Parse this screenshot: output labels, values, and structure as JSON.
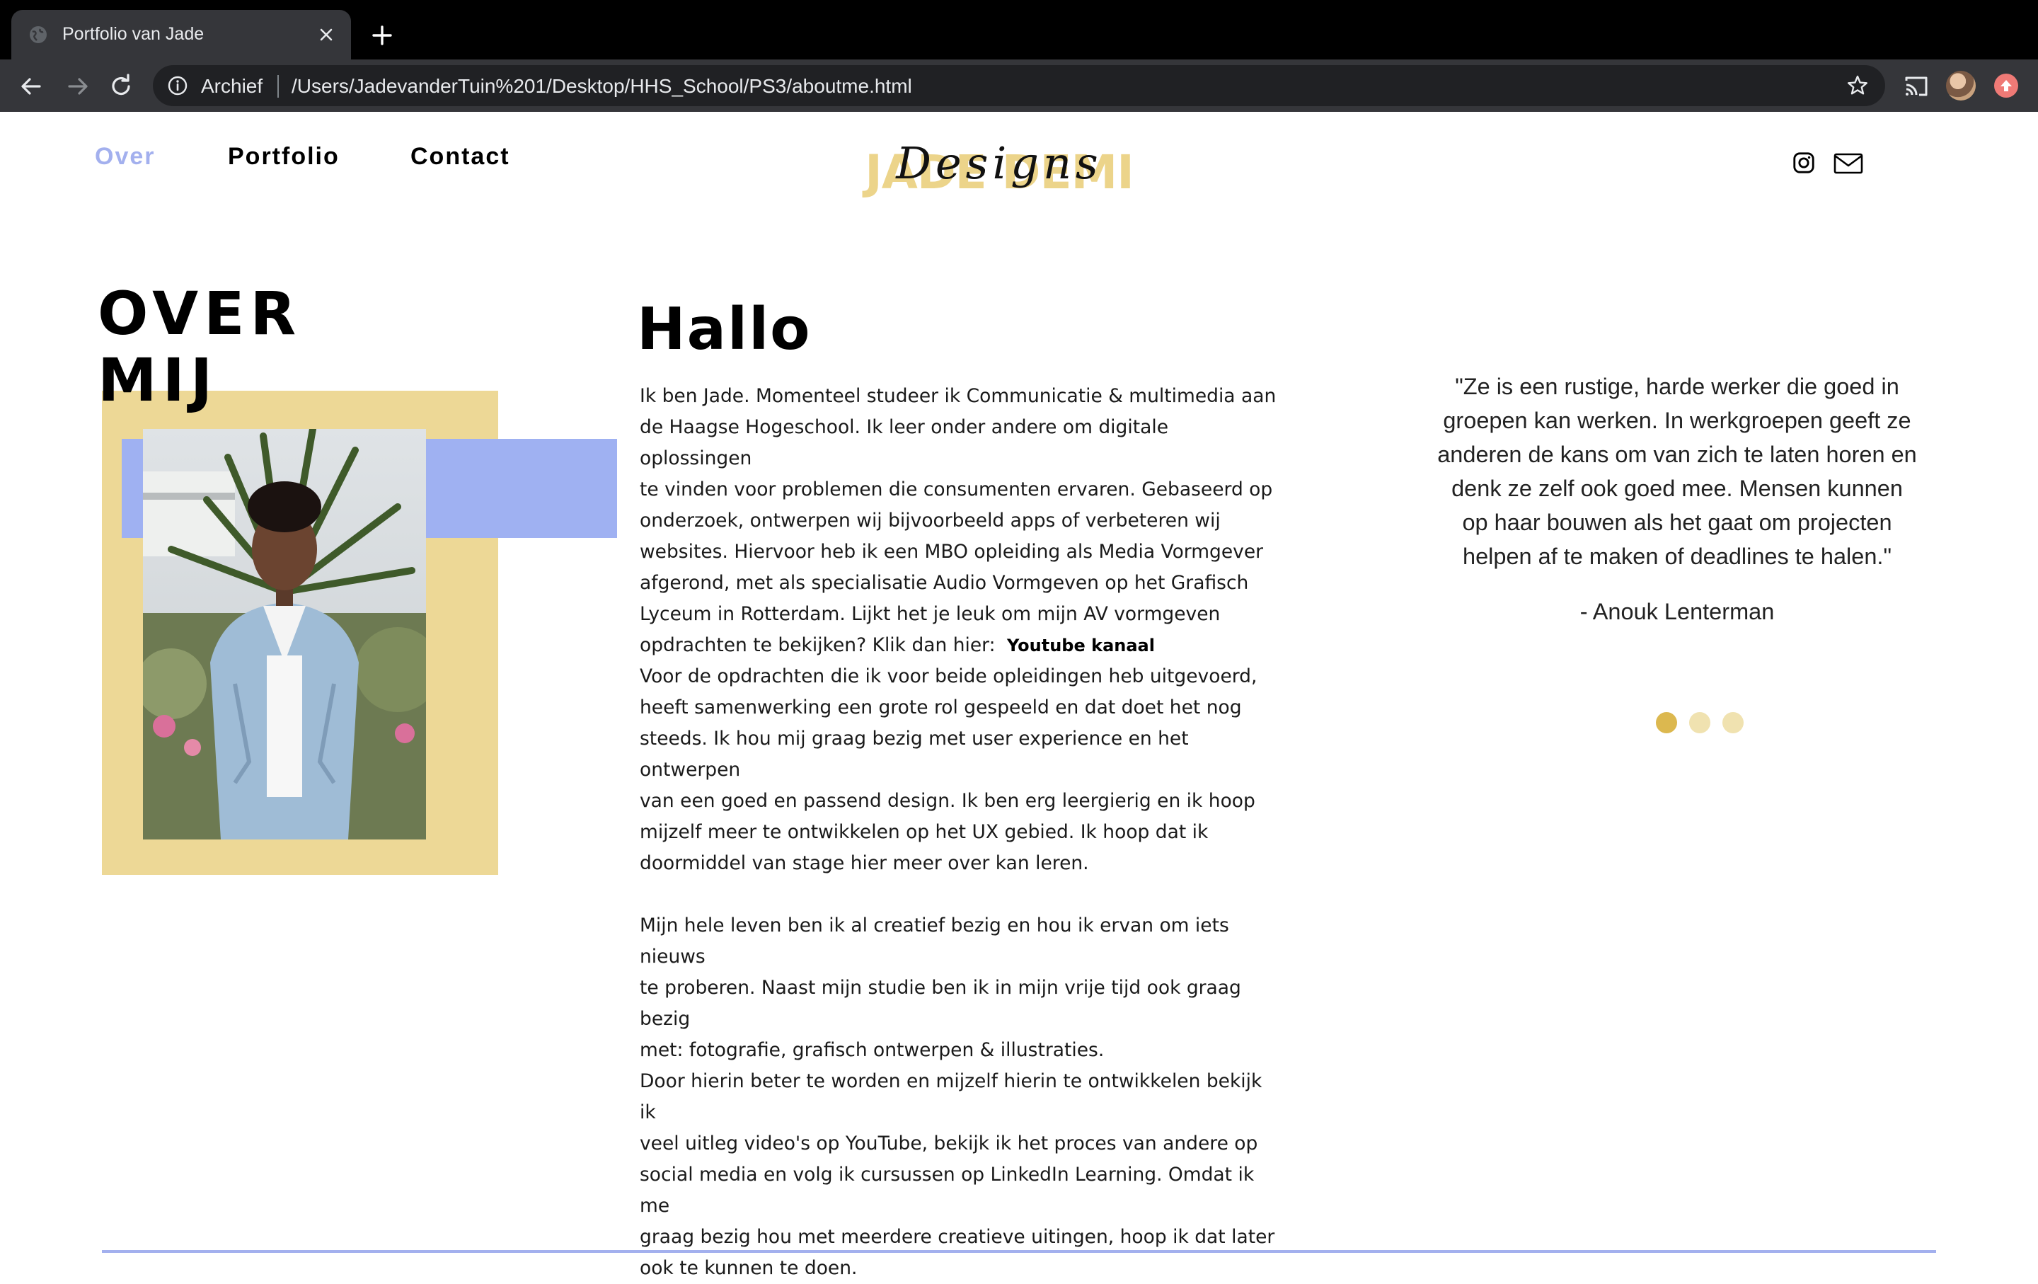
{
  "browser": {
    "tab_title": "Portfolio van Jade",
    "omnibox_label": "Archief",
    "url": "/Users/JadevanderTuin%201/Desktop/HHS_School/PS3/aboutme.html"
  },
  "nav": {
    "links": [
      {
        "label": "Over",
        "active": true
      },
      {
        "label": "Portfolio",
        "active": false
      },
      {
        "label": "Contact",
        "active": false
      }
    ],
    "logo_text_bg": "JADE DEMI",
    "logo_text_script": "Designs"
  },
  "about": {
    "title_line1": "OVER",
    "title_line2": "MIJ",
    "heading": "Hallo",
    "paragraph1_lines": [
      "Ik ben Jade. Momenteel studeer ik Communicatie & multimedia aan",
      "de Haagse Hogeschool. Ik leer onder andere om digitale oplossingen",
      "te vinden voor problemen die consumenten ervaren. Gebaseerd op",
      "onderzoek, ontwerpen wij bijvoorbeeld apps of verbeteren wij",
      "websites. Hiervoor heb ik een MBO opleiding als Media Vormgever",
      "afgerond, met als specialisatie Audio Vormgeven op het Grafisch",
      "Lyceum in Rotterdam. Lijkt het je leuk om mijn AV vormgeven"
    ],
    "paragraph1_last": "opdrachten te bekijken? Klik dan hier:",
    "youtube_link": "Youtube kanaal",
    "paragraph2_lines": [
      "Voor de opdrachten die ik voor beide opleidingen heb uitgevoerd,",
      "heeft samenwerking een grote rol gespeeld en dat doet het nog",
      "steeds. Ik hou mij graag bezig met user experience en het ontwerpen",
      "van een goed en passend design. Ik ben erg leergierig en ik hoop",
      "mijzelf meer te ontwikkelen op het UX gebied. Ik hoop dat ik",
      "doormiddel van stage hier meer over kan leren."
    ],
    "paragraph3_lines": [
      "Mijn hele leven ben ik al creatief bezig en hou ik ervan om iets nieuws",
      "te proberen. Naast mijn studie ben ik in mijn vrije tijd ook graag bezig",
      "met: fotografie, grafisch ontwerpen & illustraties.",
      "Door hierin beter te worden en mijzelf hierin te ontwikkelen bekijk ik",
      "veel uitleg video's op YouTube, bekijk ik het proces van andere op",
      "social media en volg ik cursussen op LinkedIn Learning. Omdat ik me",
      "graag bezig hou met meerdere creatieve uitingen, hoop ik dat later",
      "ook te kunnen te doen."
    ]
  },
  "testimonial": {
    "quote_lines": [
      "\"Ze is een rustige, harde werker die goed in",
      "groepen kan werken. In werkgroepen geeft ze",
      "anderen de kans om van zich te laten horen en",
      "denk ze zelf ook goed mee. Mensen kunnen",
      "op haar bouwen als het gaat om projecten",
      "helpen af te maken of deadlines te halen.\""
    ],
    "author": "- Anouk Lenterman",
    "slides_total": 3,
    "active_slide": 1
  },
  "colors": {
    "accent_blue": "#a3b0ee",
    "block_blue": "#9fb1f2",
    "block_yellow": "#edd896",
    "dot_active": "#dcb84f",
    "dot_inactive": "#f0e2b0"
  },
  "icons": {
    "instagram": "instagram-icon",
    "mail": "mail-icon",
    "star": "star-icon",
    "cast": "cast-icon",
    "info": "info-icon"
  }
}
